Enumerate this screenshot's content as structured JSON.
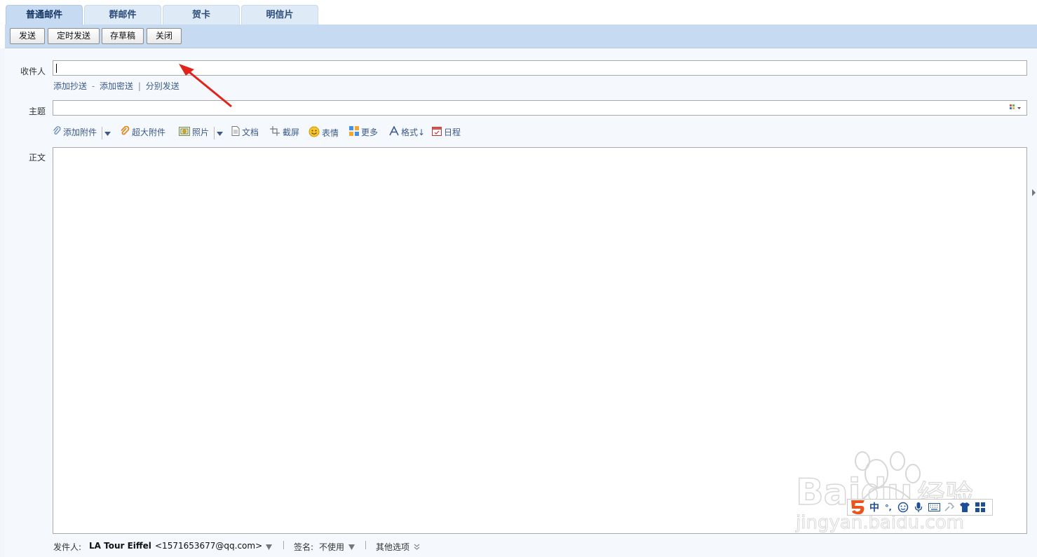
{
  "tabs": [
    {
      "label": "普通邮件",
      "active": true
    },
    {
      "label": "群邮件",
      "active": false
    },
    {
      "label": "贺卡",
      "active": false
    },
    {
      "label": "明信片",
      "active": false
    }
  ],
  "toolbar": {
    "send": "发送",
    "scheduled_send": "定时发送",
    "save_draft": "存草稿",
    "close": "关闭"
  },
  "form": {
    "recipient_label": "收件人",
    "recipient_value": "",
    "cc_links": {
      "add_cc": "添加抄送",
      "dash": "-",
      "add_bcc": "添加密送",
      "pipe": "|",
      "separate_send": "分别发送"
    },
    "subject_label": "主题",
    "subject_value": "",
    "body_label": "正文"
  },
  "editor_tools": {
    "attachment": "添加附件",
    "large_attachment": "超大附件",
    "photo": "照片",
    "document": "文档",
    "screenshot": "截屏",
    "emoji": "表情",
    "more": "更多",
    "format": "格式↓",
    "schedule": "日程"
  },
  "footer": {
    "sender_label": "发件人:",
    "sender_name": "LA Tour Eiffel",
    "sender_email": "<1571653677@qq.com>",
    "signature_label": "签名:",
    "signature_value": "不使用",
    "other_options": "其他选项"
  },
  "ime": {
    "mode": "中",
    "punct": "°,"
  },
  "watermark": {
    "brand": "Baidu",
    "brand_cn": "经验",
    "url": "jingyan.baidu.com"
  },
  "colors": {
    "tab_bg": "#dfeaf7",
    "toolbar_bg": "#c6dbf2",
    "link": "#3b5a8a",
    "annotation_arrow": "#e2231a"
  }
}
